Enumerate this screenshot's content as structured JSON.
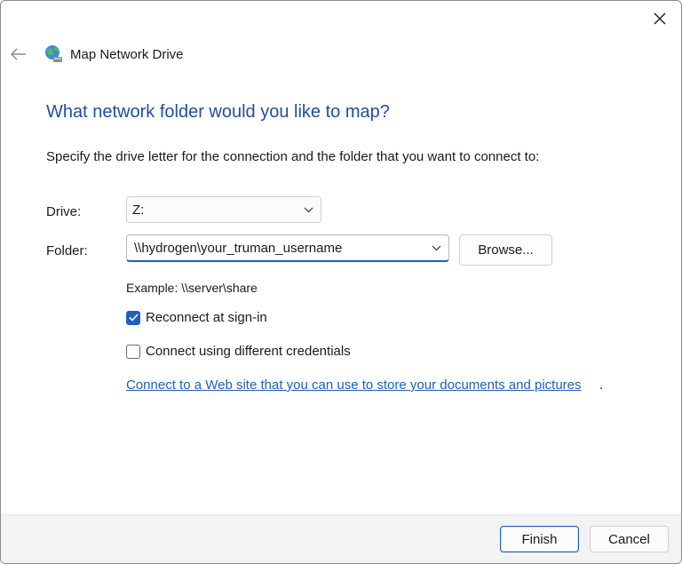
{
  "window": {
    "title": "Map Network Drive",
    "icon": "network-drive-icon"
  },
  "heading": "What network folder would you like to map?",
  "instruction": "Specify the drive letter for the connection and the folder that you want to connect to:",
  "drive": {
    "label": "Drive:",
    "value": "Z:"
  },
  "folder": {
    "label": "Folder:",
    "value": "\\\\hydrogen\\your_truman_username",
    "browse_label": "Browse..."
  },
  "example": "Example: \\\\server\\share",
  "reconnect": {
    "label": "Reconnect at sign-in",
    "checked": true
  },
  "credentials": {
    "label": "Connect using different credentials",
    "checked": false
  },
  "web_link": {
    "text": "Connect to a Web site that you can use to store your documents and pictures",
    "suffix": "."
  },
  "buttons": {
    "finish": "Finish",
    "cancel": "Cancel"
  },
  "colors": {
    "accent": "#1f5fbf",
    "heading": "#1f4fa0",
    "footer_bg": "#f3f3f3"
  }
}
